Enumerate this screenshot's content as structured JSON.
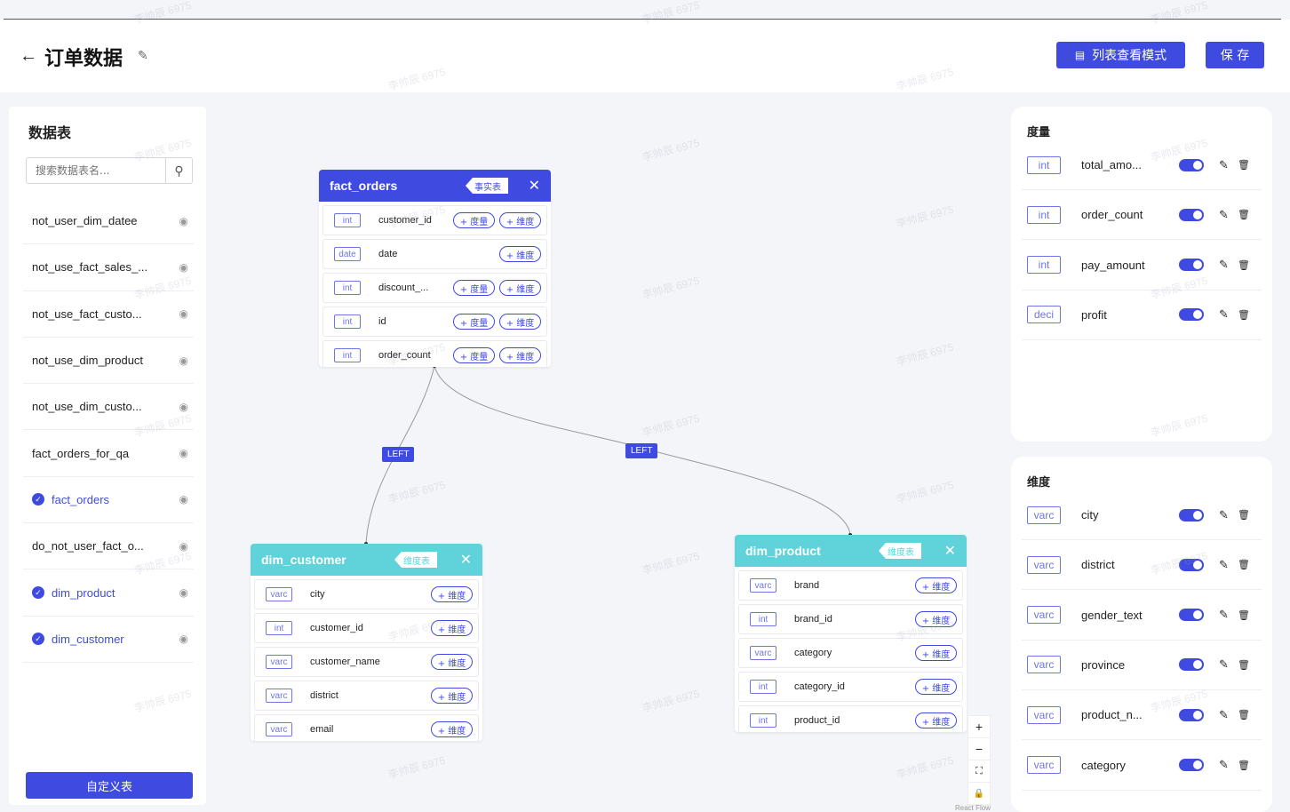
{
  "header": {
    "back_icon": "arrow-left-icon",
    "title": "订单数据",
    "list_view_label": "列表查看模式",
    "save_label": "保 存"
  },
  "left_panel": {
    "title": "数据表",
    "search_placeholder": "搜索数据表名...",
    "tables": [
      {
        "name": "not_user_dim_datee",
        "selected": false
      },
      {
        "name": "not_use_fact_sales_...",
        "selected": false
      },
      {
        "name": "not_use_fact_custo...",
        "selected": false
      },
      {
        "name": "not_use_dim_product",
        "selected": false
      },
      {
        "name": "not_use_dim_custo...",
        "selected": false
      },
      {
        "name": "fact_orders_for_qa",
        "selected": false
      },
      {
        "name": "fact_orders",
        "selected": true
      },
      {
        "name": "do_not_user_fact_o...",
        "selected": false
      },
      {
        "name": "dim_product",
        "selected": true
      },
      {
        "name": "dim_customer",
        "selected": true
      }
    ],
    "custom_table_label": "自定义表"
  },
  "canvas": {
    "edge_labels": [
      "LEFT",
      "LEFT"
    ],
    "nodes": {
      "fact_orders": {
        "name": "fact_orders",
        "tag": "事实表",
        "color": "#3f4be0",
        "fields": [
          {
            "type": "int",
            "name": "customer_id",
            "measure": "+ 度量",
            "dimension": "+ 维度"
          },
          {
            "type": "date",
            "name": "date",
            "measure": "",
            "dimension": "+ 维度"
          },
          {
            "type": "int",
            "name": "discount_...",
            "measure": "+ 度量",
            "dimension": "+ 维度"
          },
          {
            "type": "int",
            "name": "id",
            "measure": "+ 度量",
            "dimension": "+ 维度"
          },
          {
            "type": "int",
            "name": "order_count",
            "measure": "+ 度量",
            "dimension": "+ 维度"
          }
        ]
      },
      "dim_customer": {
        "name": "dim_customer",
        "tag": "维度表",
        "color": "#5fd3d9",
        "fields": [
          {
            "type": "varc",
            "name": "city",
            "dimension": "+ 维度"
          },
          {
            "type": "int",
            "name": "customer_id",
            "dimension": "+ 维度"
          },
          {
            "type": "varc",
            "name": "customer_name",
            "dimension": "+ 维度"
          },
          {
            "type": "varc",
            "name": "district",
            "dimension": "+ 维度"
          },
          {
            "type": "varc",
            "name": "email",
            "dimension": "+ 维度"
          }
        ]
      },
      "dim_product": {
        "name": "dim_product",
        "tag": "维度表",
        "color": "#5fd3d9",
        "fields": [
          {
            "type": "varc",
            "name": "brand",
            "dimension": "+ 维度"
          },
          {
            "type": "int",
            "name": "brand_id",
            "dimension": "+ 维度"
          },
          {
            "type": "varc",
            "name": "category",
            "dimension": "+ 维度"
          },
          {
            "type": "int",
            "name": "category_id",
            "dimension": "+ 维度"
          },
          {
            "type": "int",
            "name": "product_id",
            "dimension": "+ 维度"
          }
        ]
      }
    },
    "controls": {
      "zoom_in": "+",
      "zoom_out": "−",
      "fit": "⛶",
      "lock": "🔒"
    },
    "attribution": "React Flow"
  },
  "measures": {
    "title": "度量",
    "items": [
      {
        "type": "int",
        "name": "total_amo...",
        "enabled": true
      },
      {
        "type": "int",
        "name": "order_count",
        "enabled": true
      },
      {
        "type": "int",
        "name": "pay_amount",
        "enabled": true
      },
      {
        "type": "deci",
        "name": "profit",
        "enabled": true
      }
    ]
  },
  "dimensions": {
    "title": "维度",
    "items": [
      {
        "type": "varc",
        "name": "city",
        "enabled": true
      },
      {
        "type": "varc",
        "name": "district",
        "enabled": true
      },
      {
        "type": "varc",
        "name": "gender_text",
        "enabled": true
      },
      {
        "type": "varc",
        "name": "province",
        "enabled": true
      },
      {
        "type": "varc",
        "name": "product_n...",
        "enabled": true
      },
      {
        "type": "varc",
        "name": "category",
        "enabled": true
      }
    ]
  },
  "watermark": "李帅辰 6975",
  "colors": {
    "accent": "#3f4be0",
    "dim_header": "#5fd3d9"
  }
}
